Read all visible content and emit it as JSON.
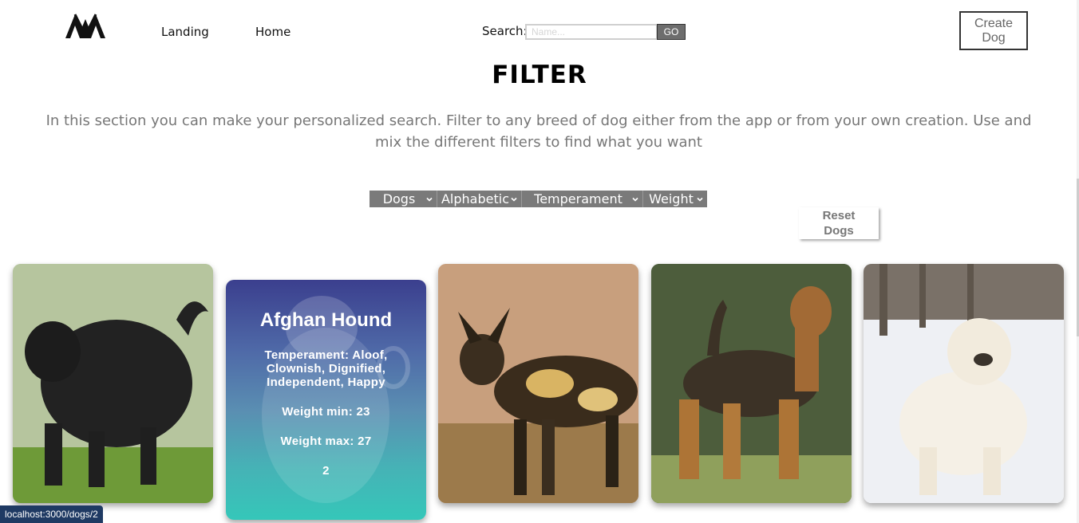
{
  "header": {
    "logo_text": "AA",
    "nav": [
      {
        "label": "Landing"
      },
      {
        "label": "Home"
      }
    ],
    "search": {
      "label": "Search:",
      "placeholder": "Name...",
      "value": "",
      "go_label": "GO"
    },
    "create_label": "Create Dog"
  },
  "main": {
    "title": "FILTER",
    "intro": "In this section you can make your personalized search. Filter to any breed of dog either from the app or from your own creation. Use and mix the different filters to find what you want",
    "filters": [
      {
        "label": "Dogs"
      },
      {
        "label": "Alphabetic"
      },
      {
        "label": "Temperament"
      },
      {
        "label": "Weight"
      }
    ],
    "reset_label": "Reset Dogs"
  },
  "cards": [
    {
      "image": "dog-photo-black-shaggy"
    },
    {
      "name": "Afghan Hound",
      "temperament": "Temperament: Aloof, Clownish, Dignified, Independent, Happy",
      "weight_min": "Weight min: 23",
      "weight_max": "Weight max: 27",
      "id": "2"
    },
    {
      "image": "dog-photo-african-wild-dog"
    },
    {
      "image": "dog-photo-airedale-terrier"
    },
    {
      "image": "dog-photo-white-in-snow"
    }
  ],
  "status_bar": {
    "url": "localhost:3000/dogs/2"
  },
  "colors": {
    "filter_bar": "#7a7a7a",
    "go_button": "#6d6d6d",
    "hover_gradient_top": "#3b3f8e",
    "hover_gradient_bottom": "#35c7b9",
    "status_bar": "#1f3a63"
  }
}
